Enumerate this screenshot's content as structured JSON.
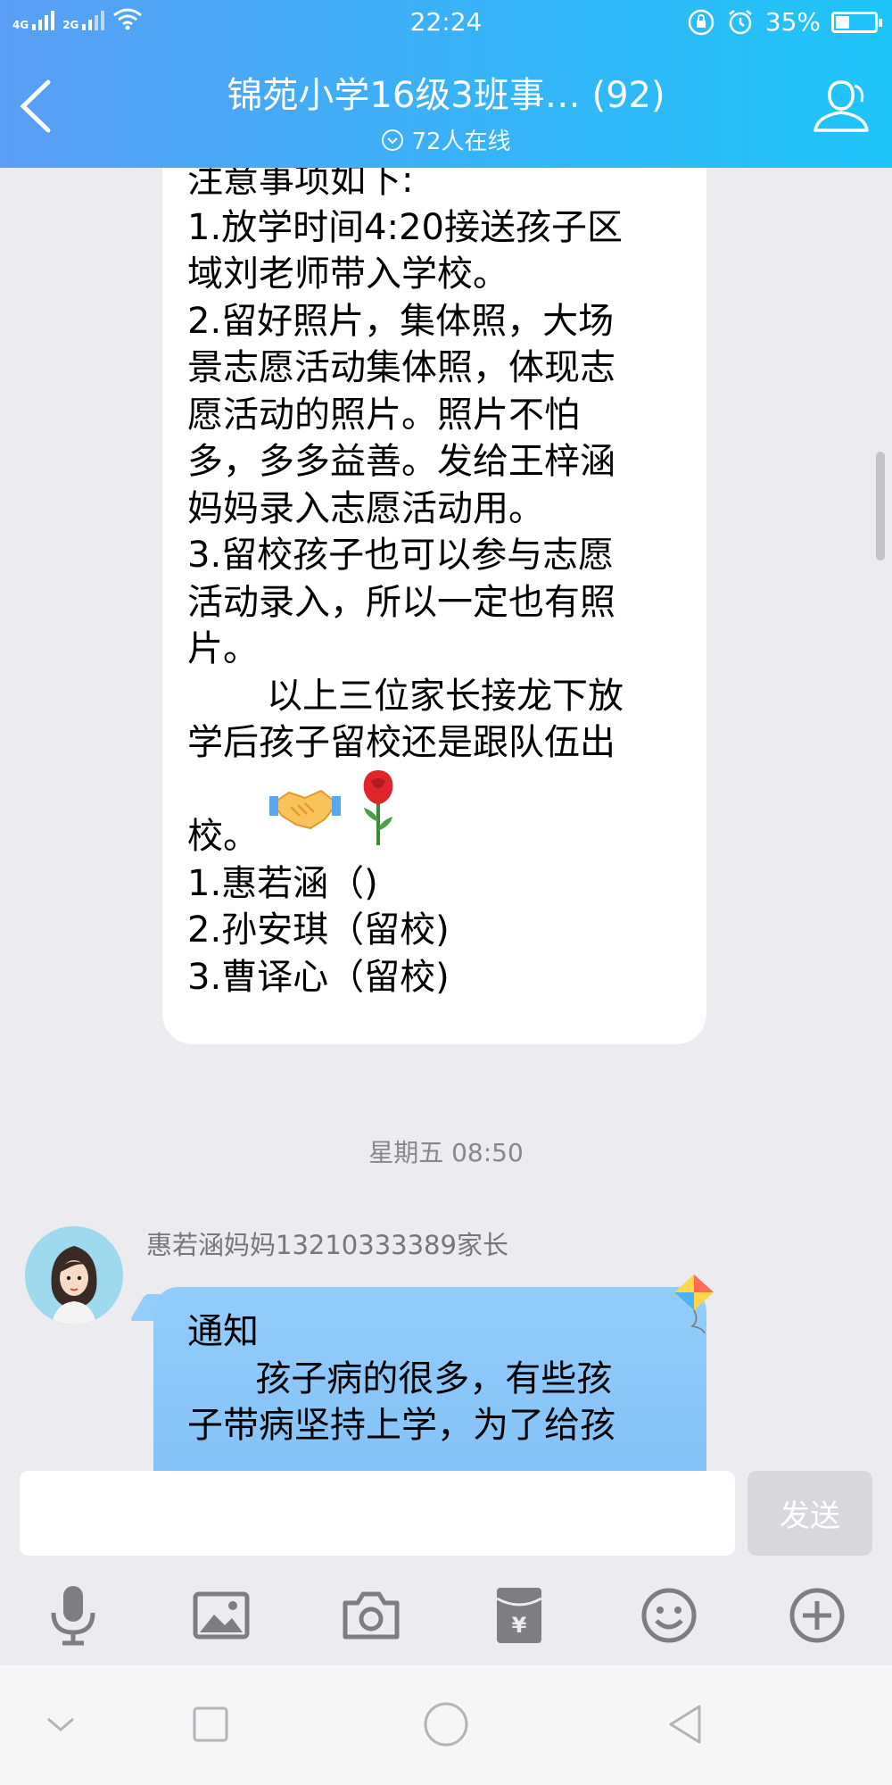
{
  "status_bar": {
    "network_1": "4G",
    "network_2": "2G",
    "time": "22:24",
    "battery": "35%",
    "battery_level": 0.35
  },
  "header": {
    "title": "锦苑小学16级3班事… (92)",
    "online": "72人在线"
  },
  "message_1": {
    "lines": [
      "注意事项如下:",
      "1.放学时间4:20接送孩子区",
      "域刘老师带入学校。",
      "2.留好照片，集体照，大场",
      "景志愿活动集体照，体现志",
      "愿活动的照片。照片不怕",
      "多，多多益善。发给王梓涵",
      "妈妈录入志愿活动用。",
      "3.留校孩子也可以参与志愿",
      "活动录入，所以一定也有照",
      "片。",
      "       以上三位家长接龙下放",
      "学后孩子留校还是跟队伍出"
    ],
    "emoji_line_text": "校。",
    "emoji_1": "handshake-emoji",
    "emoji_2": "rose-emoji",
    "list": [
      "1.惠若涵（)",
      "2.孙安琪（留校)",
      "3.曹译心（留校)"
    ]
  },
  "time_separator": "星期五 08:50",
  "message_2": {
    "sender": "惠若涵妈妈13210333389家长",
    "lines": [
      "通知",
      "      孩子病的很多，有些孩",
      "子带病坚持上学，为了给孩"
    ]
  },
  "input": {
    "placeholder": "",
    "send_label": "发送"
  },
  "toolbar": {
    "icons": [
      "microphone-icon",
      "image-icon",
      "camera-icon",
      "red-packet-icon",
      "emoji-icon",
      "plus-icon"
    ]
  },
  "colors": {
    "header_start": "#5a9ef5",
    "header_end": "#1ec5f9",
    "blue_bubble": "#93cdfa",
    "background": "#ebebf0"
  }
}
